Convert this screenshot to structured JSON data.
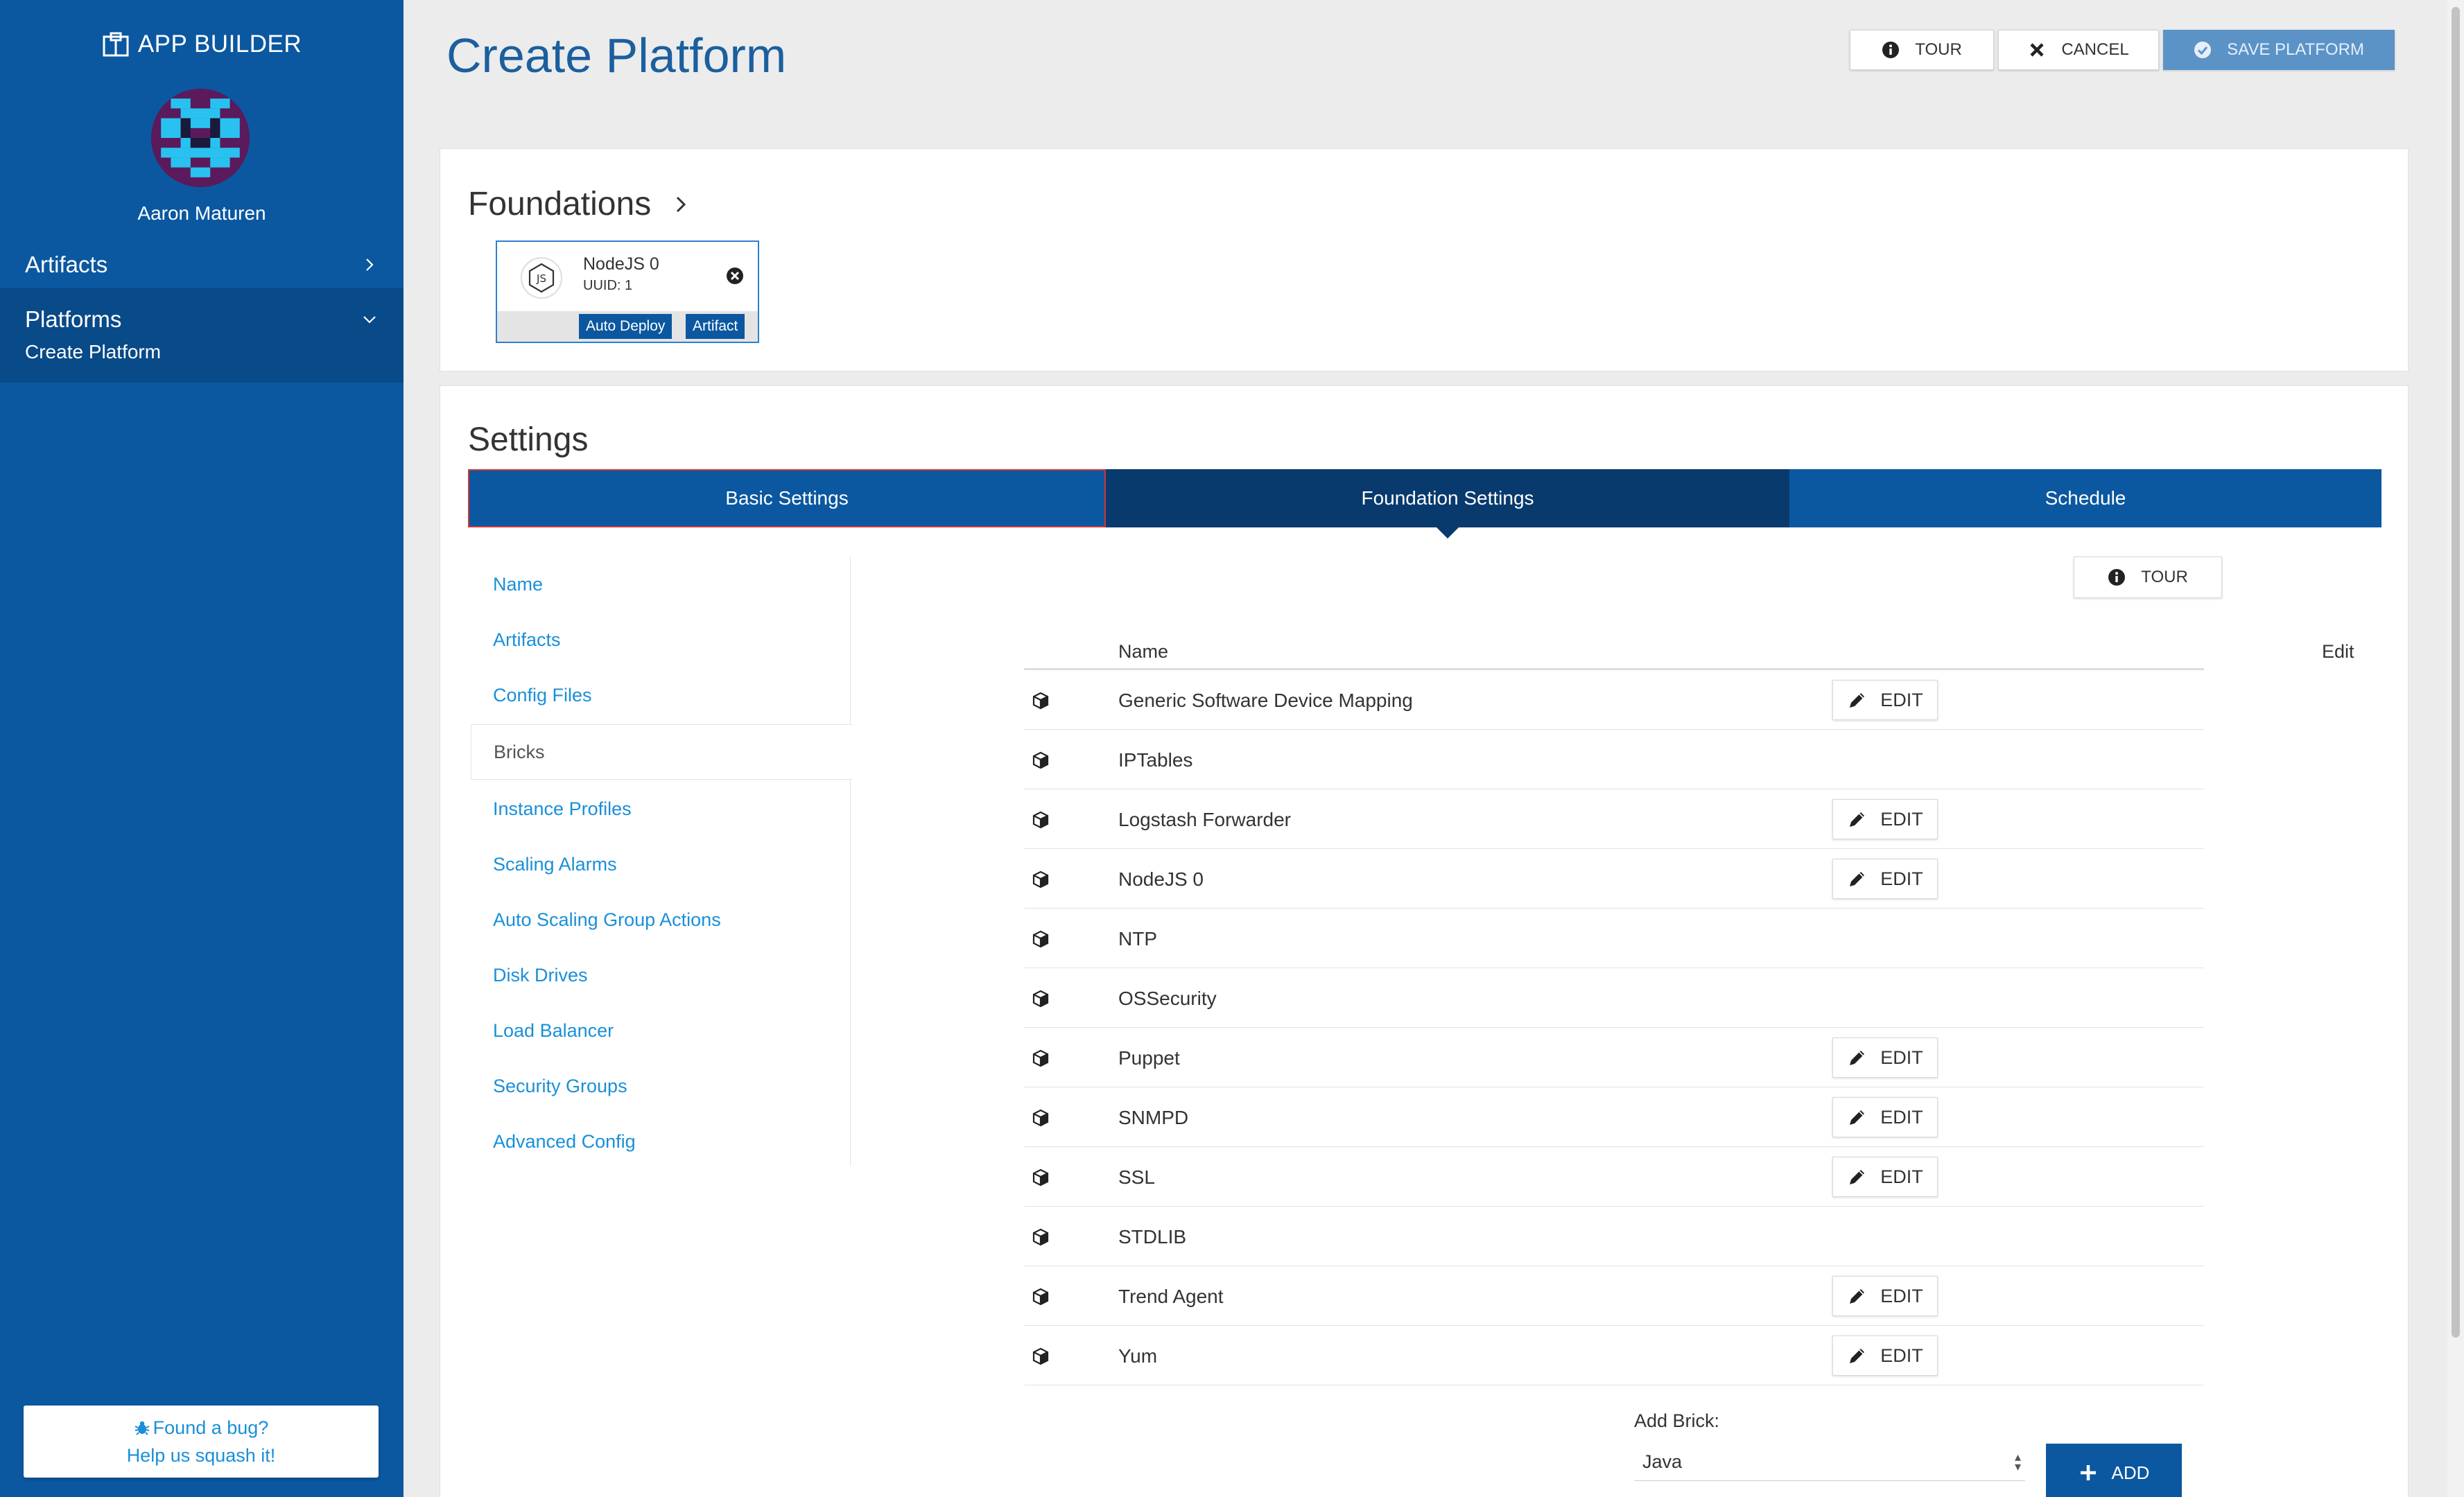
{
  "sidebar": {
    "brand": "APP BUILDER",
    "user_name": "Aaron Maturen",
    "nav": {
      "artifacts": "Artifacts",
      "platforms": "Platforms",
      "create_platform": "Create Platform"
    },
    "bug": {
      "line1": "Found a bug?",
      "line2": "Help us squash it!"
    }
  },
  "header": {
    "title": "Create Platform",
    "tour": "TOUR",
    "cancel": "CANCEL",
    "save": "SAVE PLATFORM"
  },
  "foundations": {
    "title": "Foundations",
    "tile": {
      "name": "NodeJS 0",
      "uuid": "UUID: 1",
      "badge_deploy": "Auto Deploy",
      "badge_artifact": "Artifact"
    }
  },
  "settings": {
    "title": "Settings",
    "tabs": [
      "Basic Settings",
      "Foundation Settings",
      "Schedule"
    ],
    "subnav": [
      "Name",
      "Artifacts",
      "Config Files",
      "Bricks",
      "Instance Profiles",
      "Scaling Alarms",
      "Auto Scaling Group Actions",
      "Disk Drives",
      "Load Balancer",
      "Security Groups",
      "Advanced Config"
    ],
    "tour": "TOUR",
    "table": {
      "col_name": "Name",
      "col_edit": "Edit",
      "edit_label": "EDIT",
      "rows": [
        {
          "name": "Generic Software Device Mapping",
          "editable": true
        },
        {
          "name": "IPTables",
          "editable": false
        },
        {
          "name": "Logstash Forwarder",
          "editable": true
        },
        {
          "name": "NodeJS 0",
          "editable": true
        },
        {
          "name": "NTP",
          "editable": false
        },
        {
          "name": "OSSecurity",
          "editable": false
        },
        {
          "name": "Puppet",
          "editable": true
        },
        {
          "name": "SNMPD",
          "editable": true
        },
        {
          "name": "SSL",
          "editable": true
        },
        {
          "name": "STDLIB",
          "editable": false
        },
        {
          "name": "Trend Agent",
          "editable": true
        },
        {
          "name": "Yum",
          "editable": true
        }
      ]
    },
    "add_brick": {
      "label": "Add Brick:",
      "selected": "Java",
      "button": "ADD"
    }
  },
  "colors": {
    "sidebar": "#0b58a0",
    "tab_active": "#083a6d",
    "link": "#1a8fd8",
    "title": "#1b5f9e",
    "save_btn": "#5b93c7"
  }
}
